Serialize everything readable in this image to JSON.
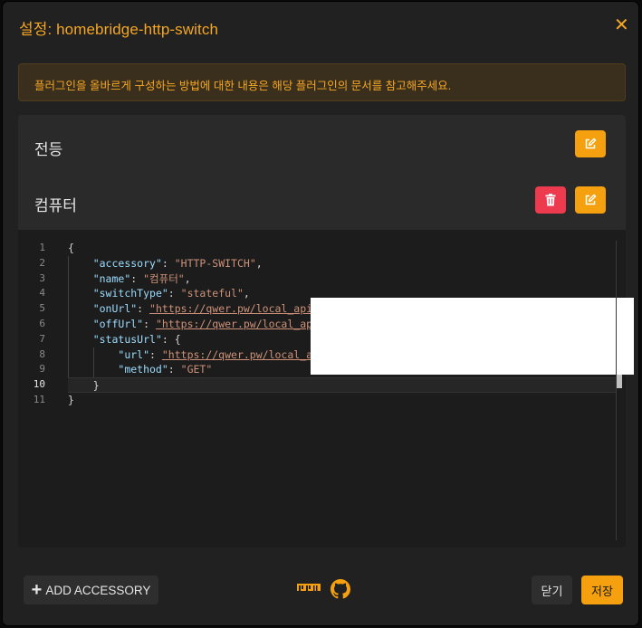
{
  "dialog": {
    "title": "설정: homebridge-http-switch",
    "close_glyph": "✕"
  },
  "alert": {
    "text": "플러그인을 올바르게 구성하는 방법에 대한 내용은 해당 플러그인의 문서를 참고해주세요."
  },
  "accessories": [
    {
      "name": "전등"
    },
    {
      "name": "컴퓨터"
    }
  ],
  "editor": {
    "line_numbers": [
      "1",
      "2",
      "3",
      "4",
      "5",
      "6",
      "7",
      "8",
      "9",
      "10",
      "11"
    ],
    "active_line": "10",
    "tokens": {
      "open_brace": "{",
      "close_brace": "}",
      "accessory_key": "\"accessory\"",
      "accessory_val": "\"HTTP-SWITCH\"",
      "name_key": "\"name\"",
      "name_val": "\"컴퓨터\"",
      "switchType_key": "\"switchType\"",
      "switchType_val": "\"stateful\"",
      "onUrl_key": "\"onUrl\"",
      "onUrl_val": "\"https://qwer.pw/local_api/",
      "offUrl_key": "\"offUrl\"",
      "offUrl_val": "\"https://qwer.pw/local_api",
      "statusUrl_key": "\"statusUrl\"",
      "url_key": "\"url\"",
      "url_val": "\"https://qwer.pw/local_ap",
      "method_key": "\"method\"",
      "method_val": "\"GET\"",
      "colon": ": ",
      "comma": ","
    }
  },
  "footer": {
    "add_accessory_label": "ADD ACCESSORY",
    "close_label": "닫기",
    "save_label": "저장"
  },
  "colors": {
    "accent": "#f5a00e",
    "danger": "#ee3a4f",
    "json_key": "#9cdcfe",
    "json_string": "#ce9178"
  },
  "icons": [
    "close-icon",
    "edit-icon",
    "trash-icon",
    "plus-icon",
    "npm-icon",
    "github-icon"
  ]
}
